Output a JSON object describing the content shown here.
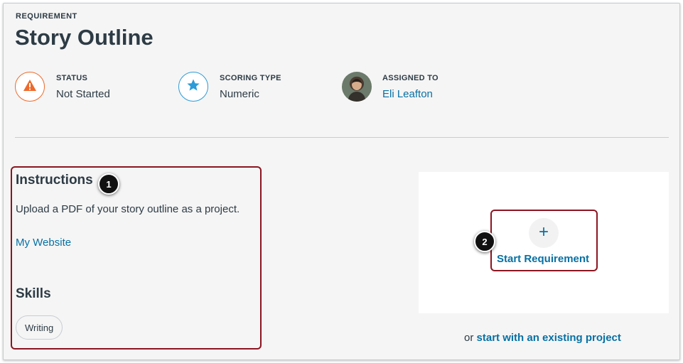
{
  "header": {
    "eyebrow": "REQUIREMENT",
    "title": "Story Outline"
  },
  "meta": {
    "status": {
      "label": "STATUS",
      "value": "Not Started",
      "icon": "warning-icon",
      "color": "#ee6a2a"
    },
    "scoring": {
      "label": "SCORING TYPE",
      "value": "Numeric",
      "icon": "star-icon",
      "color": "#2d9bd7"
    },
    "assigned": {
      "label": "ASSIGNED TO",
      "value": "Eli Leafton",
      "icon": "avatar"
    }
  },
  "instructions": {
    "heading": "Instructions",
    "text": "Upload a PDF of your story outline as a project.",
    "link": "My Website"
  },
  "skills": {
    "heading": "Skills",
    "items": [
      "Writing"
    ]
  },
  "action": {
    "plus": "+",
    "start_label": "Start Requirement",
    "footer_prefix": "or",
    "footer_link": "start with an existing project"
  },
  "annotations": {
    "badge_1": "1",
    "badge_2": "2"
  },
  "colors": {
    "link": "#0770a3",
    "highlight": "#8b1520",
    "text": "#2d3b45"
  }
}
